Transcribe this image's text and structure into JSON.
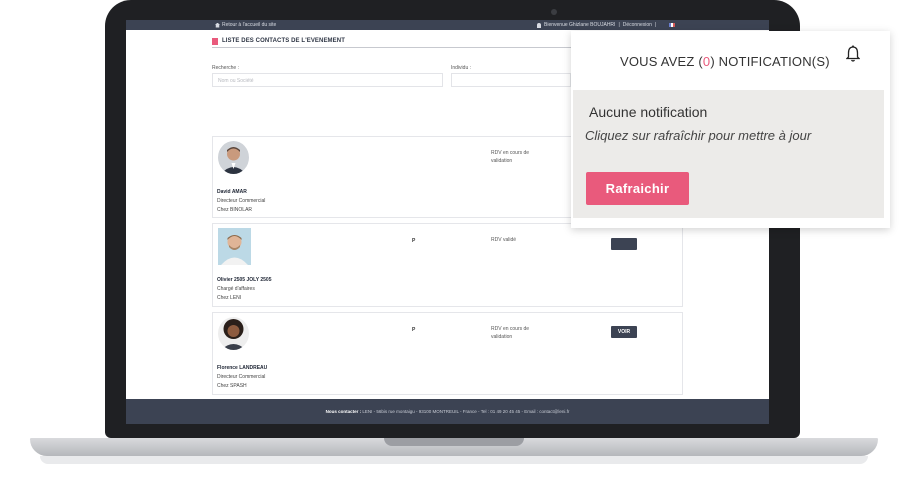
{
  "topbar": {
    "home_link": "Retour à l'accueil du site",
    "welcome": "Bienvenue Ghizlane BOUJAHRI",
    "separator": "|",
    "logout": "Déconnexion",
    "separator2": "|"
  },
  "page": {
    "title": "LISTE DES CONTACTS DE L'EVENEMENT"
  },
  "filters": {
    "search_label": "Recherche :",
    "search_placeholder": "Nom ou Société",
    "individual_label": "Individu :"
  },
  "contacts": [
    {
      "name": "David AMAR",
      "role": "Directeur Commercial",
      "company": "Chez BINOLAR",
      "type": "",
      "status": "RDV en cours de validation",
      "action": ""
    },
    {
      "name": "Olivier 2505 JOLY 2505",
      "role": "Chargé d'affaires",
      "company": "Chez LENI",
      "type": "P",
      "status": "RDV validé",
      "action": ""
    },
    {
      "name": "Florence LANDREAU",
      "role": "Directeur Commercial",
      "company": "Chez SPASH",
      "type": "P",
      "status": "RDV en cours de validation",
      "action": "VOIR"
    }
  ],
  "footer": {
    "label": "Nous contacter :",
    "text": "LENI - 56bis rue montaigu - 93100 MONTREUIL - France - Tel : 01 49 20 45 45 - Email : contact@leni.fr"
  },
  "notification": {
    "prefix": "VOUS AVEZ (",
    "count": "0",
    "suffix": ") NOTIFICATION(S)",
    "empty": "Aucune notification",
    "hint": "Cliquez sur rafraîchir pour mettre à jour",
    "refresh_label": "Rafraichir",
    "icon": "bell-icon"
  },
  "colors": {
    "accent": "#e95a7c",
    "dark": "#3c4353",
    "panel": "#ecebe9"
  }
}
